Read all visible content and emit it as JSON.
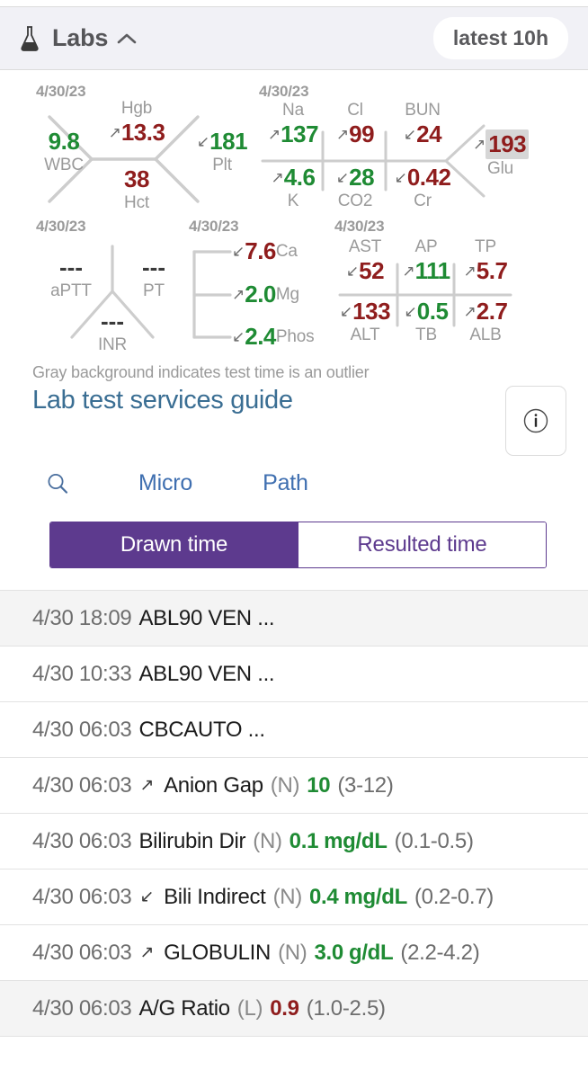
{
  "header": {
    "title": "Labs",
    "flask_icon": "flask-icon",
    "collapse_icon": "chevron-up-icon",
    "badge": "latest 10h"
  },
  "panels": {
    "cbc": {
      "date": "4/30/23",
      "wbc": {
        "label": "WBC",
        "value": "9.8",
        "status": "norm",
        "arrow": ""
      },
      "hgb": {
        "label": "Hgb",
        "value": "13.3",
        "status": "high",
        "arrow": "↗"
      },
      "hct": {
        "label": "Hct",
        "value": "38",
        "status": "high",
        "arrow": ""
      },
      "plt": {
        "label": "Plt",
        "value": "181",
        "status": "norm",
        "arrow": "↙"
      }
    },
    "bmp": {
      "date": "4/30/23",
      "na": {
        "label": "Na",
        "value": "137",
        "status": "norm",
        "arrow": "↗"
      },
      "cl": {
        "label": "Cl",
        "value": "99",
        "status": "high",
        "arrow": "↗"
      },
      "bun": {
        "label": "BUN",
        "value": "24",
        "status": "high",
        "arrow": "↙"
      },
      "k": {
        "label": "K",
        "value": "4.6",
        "status": "norm",
        "arrow": "↗"
      },
      "co2": {
        "label": "CO2",
        "value": "28",
        "status": "norm",
        "arrow": "↙"
      },
      "cr": {
        "label": "Cr",
        "value": "0.42",
        "status": "high",
        "arrow": "↙"
      },
      "glu": {
        "label": "Glu",
        "value": "193",
        "status": "high",
        "arrow": "↗",
        "outlier": true
      }
    },
    "coags": {
      "date": "4/30/23",
      "aptt": {
        "label": "aPTT",
        "value": "---"
      },
      "pt": {
        "label": "PT",
        "value": "---"
      },
      "inr": {
        "label": "INR",
        "value": "---"
      }
    },
    "lytes": {
      "date": "4/30/23",
      "rows": [
        {
          "label": "Ca",
          "value": "7.6",
          "status": "high",
          "arrow": "↙"
        },
        {
          "label": "Mg",
          "value": "2.0",
          "status": "norm",
          "arrow": "↗"
        },
        {
          "label": "Phos",
          "value": "2.4",
          "status": "norm",
          "arrow": "↙"
        }
      ]
    },
    "lft": {
      "date": "4/30/23",
      "ast": {
        "label": "AST",
        "value": "52",
        "status": "high",
        "arrow": "↙"
      },
      "ap": {
        "label": "AP",
        "value": "111",
        "status": "norm",
        "arrow": "↗"
      },
      "tp": {
        "label": "TP",
        "value": "5.7",
        "status": "high",
        "arrow": "↗"
      },
      "alt": {
        "label": "ALT",
        "value": "133",
        "status": "high",
        "arrow": "↙"
      },
      "tb": {
        "label": "TB",
        "value": "0.5",
        "status": "norm",
        "arrow": "↙"
      },
      "alb": {
        "label": "ALB",
        "value": "2.7",
        "status": "high",
        "arrow": "↗"
      }
    }
  },
  "footnote": "Gray background indicates test time is an outlier",
  "guide_link": "Lab test services guide",
  "info_button": "info-icon",
  "links": {
    "search_icon": "search-icon",
    "micro": "Micro",
    "path": "Path"
  },
  "toggle": {
    "drawn": "Drawn time",
    "resulted": "Resulted time",
    "active": "drawn"
  },
  "results": [
    {
      "time": "4/30 18:09",
      "arrow": "",
      "name": "ABL90 VEN ...",
      "flag": "",
      "value": "",
      "unit": "",
      "range": "",
      "status": "",
      "shaded": true
    },
    {
      "time": "4/30 10:33",
      "arrow": "",
      "name": "ABL90 VEN ...",
      "flag": "",
      "value": "",
      "unit": "",
      "range": "",
      "status": "",
      "shaded": false
    },
    {
      "time": "4/30 06:03",
      "arrow": "",
      "name": "CBCAUTO ...",
      "flag": "",
      "value": "",
      "unit": "",
      "range": "",
      "status": "",
      "shaded": false
    },
    {
      "time": "4/30 06:03",
      "arrow": "↗",
      "name": "Anion Gap",
      "flag": "(N)",
      "value": "10",
      "unit": "",
      "range": "(3-12)",
      "status": "norm",
      "shaded": false
    },
    {
      "time": "4/30 06:03",
      "arrow": "",
      "name": "Bilirubin Dir",
      "flag": "(N)",
      "value": "0.1",
      "unit": "mg/dL",
      "range": "(0.1-0.5)",
      "status": "norm",
      "shaded": false
    },
    {
      "time": "4/30 06:03",
      "arrow": "↙",
      "name": "Bili Indirect",
      "flag": "(N)",
      "value": "0.4",
      "unit": "mg/dL",
      "range": "(0.2-0.7)",
      "status": "norm",
      "shaded": false
    },
    {
      "time": "4/30 06:03",
      "arrow": "↗",
      "name": "GLOBULIN",
      "flag": "(N)",
      "value": "3.0",
      "unit": "g/dL",
      "range": "(2.2-4.2)",
      "status": "norm",
      "shaded": false
    },
    {
      "time": "4/30 06:03",
      "arrow": "",
      "name": "A/G Ratio",
      "flag": "(L)",
      "value": "0.9",
      "unit": "",
      "range": "(1.0-2.5)",
      "status": "abn",
      "shaded": true
    }
  ],
  "colors": {
    "accent_purple": "#5d3a8e",
    "link_blue": "#3f6fb0",
    "guide_blue": "#3a6e93",
    "normal_green": "#1f8b34",
    "abnormal_red": "#8f1d1d",
    "label_gray": "#9a9a9a",
    "header_bg": "#f1f1f6",
    "outlier_bg": "#d6d6d6"
  }
}
